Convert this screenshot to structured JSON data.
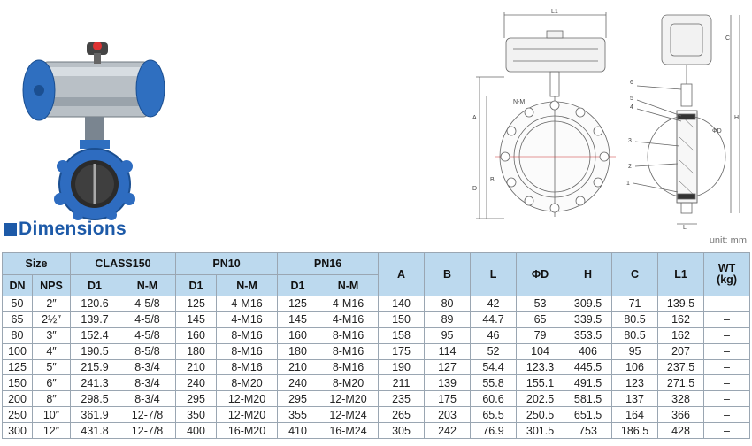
{
  "heading": "Dimensions",
  "unit_label": "unit: mm",
  "drawing_labels": {
    "L1": "L1",
    "NM": "N-M",
    "A": "A",
    "B": "B",
    "D": "D",
    "C": "C",
    "H": "H",
    "L": "L",
    "phiD": "ΦD",
    "parts": [
      "6",
      "5",
      "4",
      "3",
      "2",
      "1"
    ]
  },
  "table": {
    "group_headers": {
      "size": "Size",
      "class150": "CLASS150",
      "pn10": "PN10",
      "pn16": "PN16",
      "a": "A",
      "b": "B",
      "l": "L",
      "phid": "ΦD",
      "h": "H",
      "c": "C",
      "l1": "L1",
      "wt": "WT\n(kg)"
    },
    "sub_headers": [
      "DN",
      "NPS",
      "D1",
      "N-M",
      "D1",
      "N-M",
      "D1",
      "N-M"
    ],
    "rows": [
      [
        "50",
        "2″",
        "120.6",
        "4-5/8",
        "125",
        "4-M16",
        "125",
        "4-M16",
        "140",
        "80",
        "42",
        "53",
        "309.5",
        "71",
        "139.5",
        "–"
      ],
      [
        "65",
        "2½″",
        "139.7",
        "4-5/8",
        "145",
        "4-M16",
        "145",
        "4-M16",
        "150",
        "89",
        "44.7",
        "65",
        "339.5",
        "80.5",
        "162",
        "–"
      ],
      [
        "80",
        "3″",
        "152.4",
        "4-5/8",
        "160",
        "8-M16",
        "160",
        "8-M16",
        "158",
        "95",
        "46",
        "79",
        "353.5",
        "80.5",
        "162",
        "–"
      ],
      [
        "100",
        "4″",
        "190.5",
        "8-5/8",
        "180",
        "8-M16",
        "180",
        "8-M16",
        "175",
        "114",
        "52",
        "104",
        "406",
        "95",
        "207",
        "–"
      ],
      [
        "125",
        "5″",
        "215.9",
        "8-3/4",
        "210",
        "8-M16",
        "210",
        "8-M16",
        "190",
        "127",
        "54.4",
        "123.3",
        "445.5",
        "106",
        "237.5",
        "–"
      ],
      [
        "150",
        "6″",
        "241.3",
        "8-3/4",
        "240",
        "8-M20",
        "240",
        "8-M20",
        "211",
        "139",
        "55.8",
        "155.1",
        "491.5",
        "123",
        "271.5",
        "–"
      ],
      [
        "200",
        "8″",
        "298.5",
        "8-3/4",
        "295",
        "12-M20",
        "295",
        "12-M20",
        "235",
        "175",
        "60.6",
        "202.5",
        "581.5",
        "137",
        "328",
        "–"
      ],
      [
        "250",
        "10″",
        "361.9",
        "12-7/8",
        "350",
        "12-M20",
        "355",
        "12-M24",
        "265",
        "203",
        "65.5",
        "250.5",
        "651.5",
        "164",
        "366",
        "–"
      ],
      [
        "300",
        "12″",
        "431.8",
        "12-7/8",
        "400",
        "16-M20",
        "410",
        "16-M24",
        "305",
        "242",
        "76.9",
        "301.5",
        "753",
        "186.5",
        "428",
        "–"
      ]
    ]
  }
}
